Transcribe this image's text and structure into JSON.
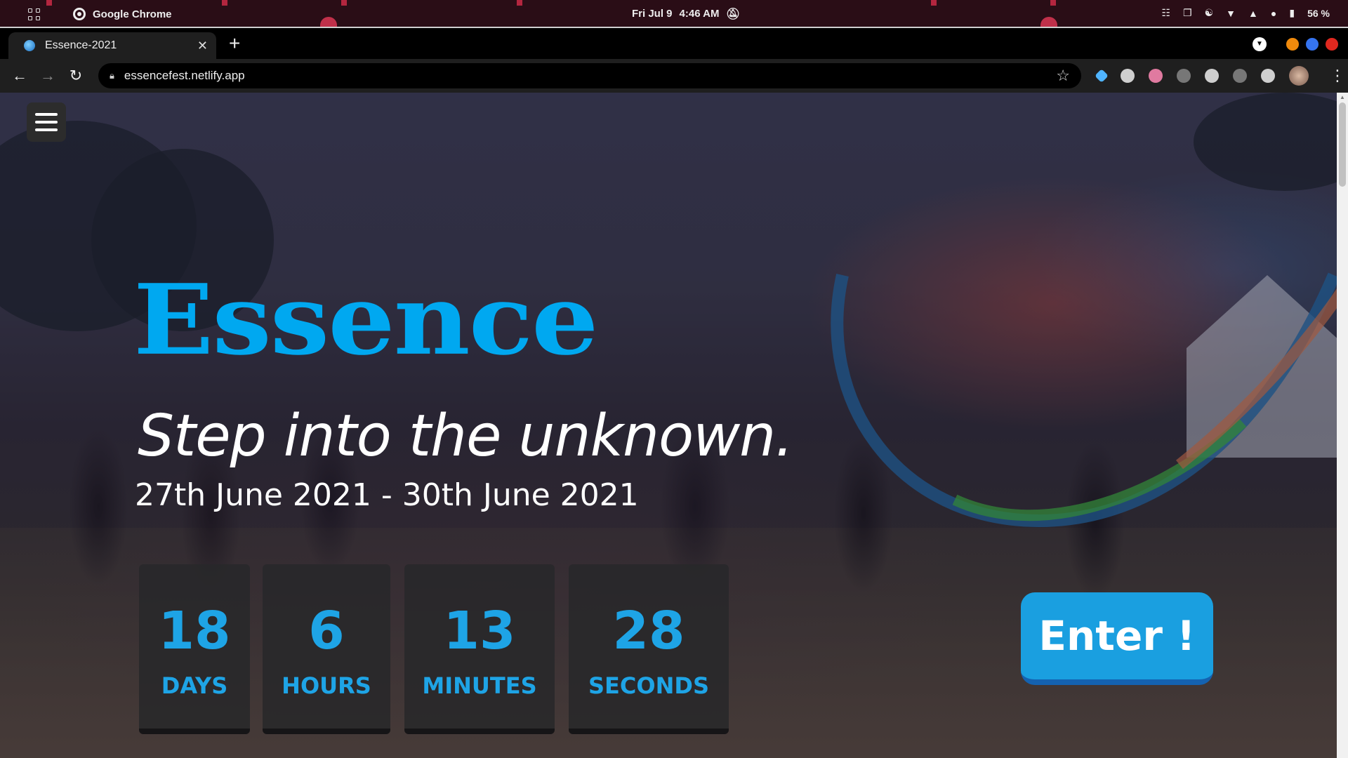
{
  "os": {
    "app_name": "Google Chrome",
    "date": "Fri Jul 9",
    "time": "4:46 AM",
    "battery": "56 %"
  },
  "browser": {
    "tab_title": "Essence-2021",
    "url": "essencefest.netlify.app"
  },
  "hero": {
    "brand": "Essence",
    "tagline": "Step into the unknown.",
    "dates": "27th June 2021 - 30th June 2021",
    "enter_label": "Enter !"
  },
  "countdown": [
    {
      "value": "18",
      "label": "DAYS"
    },
    {
      "value": "6",
      "label": "HOURS"
    },
    {
      "value": "13",
      "label": "MINUTES"
    },
    {
      "value": "28",
      "label": "SECONDS"
    }
  ],
  "colors": {
    "accent": "#00a8f0",
    "countdown_text": "#1ea4e6",
    "enter_button": "#1a9fe0"
  }
}
